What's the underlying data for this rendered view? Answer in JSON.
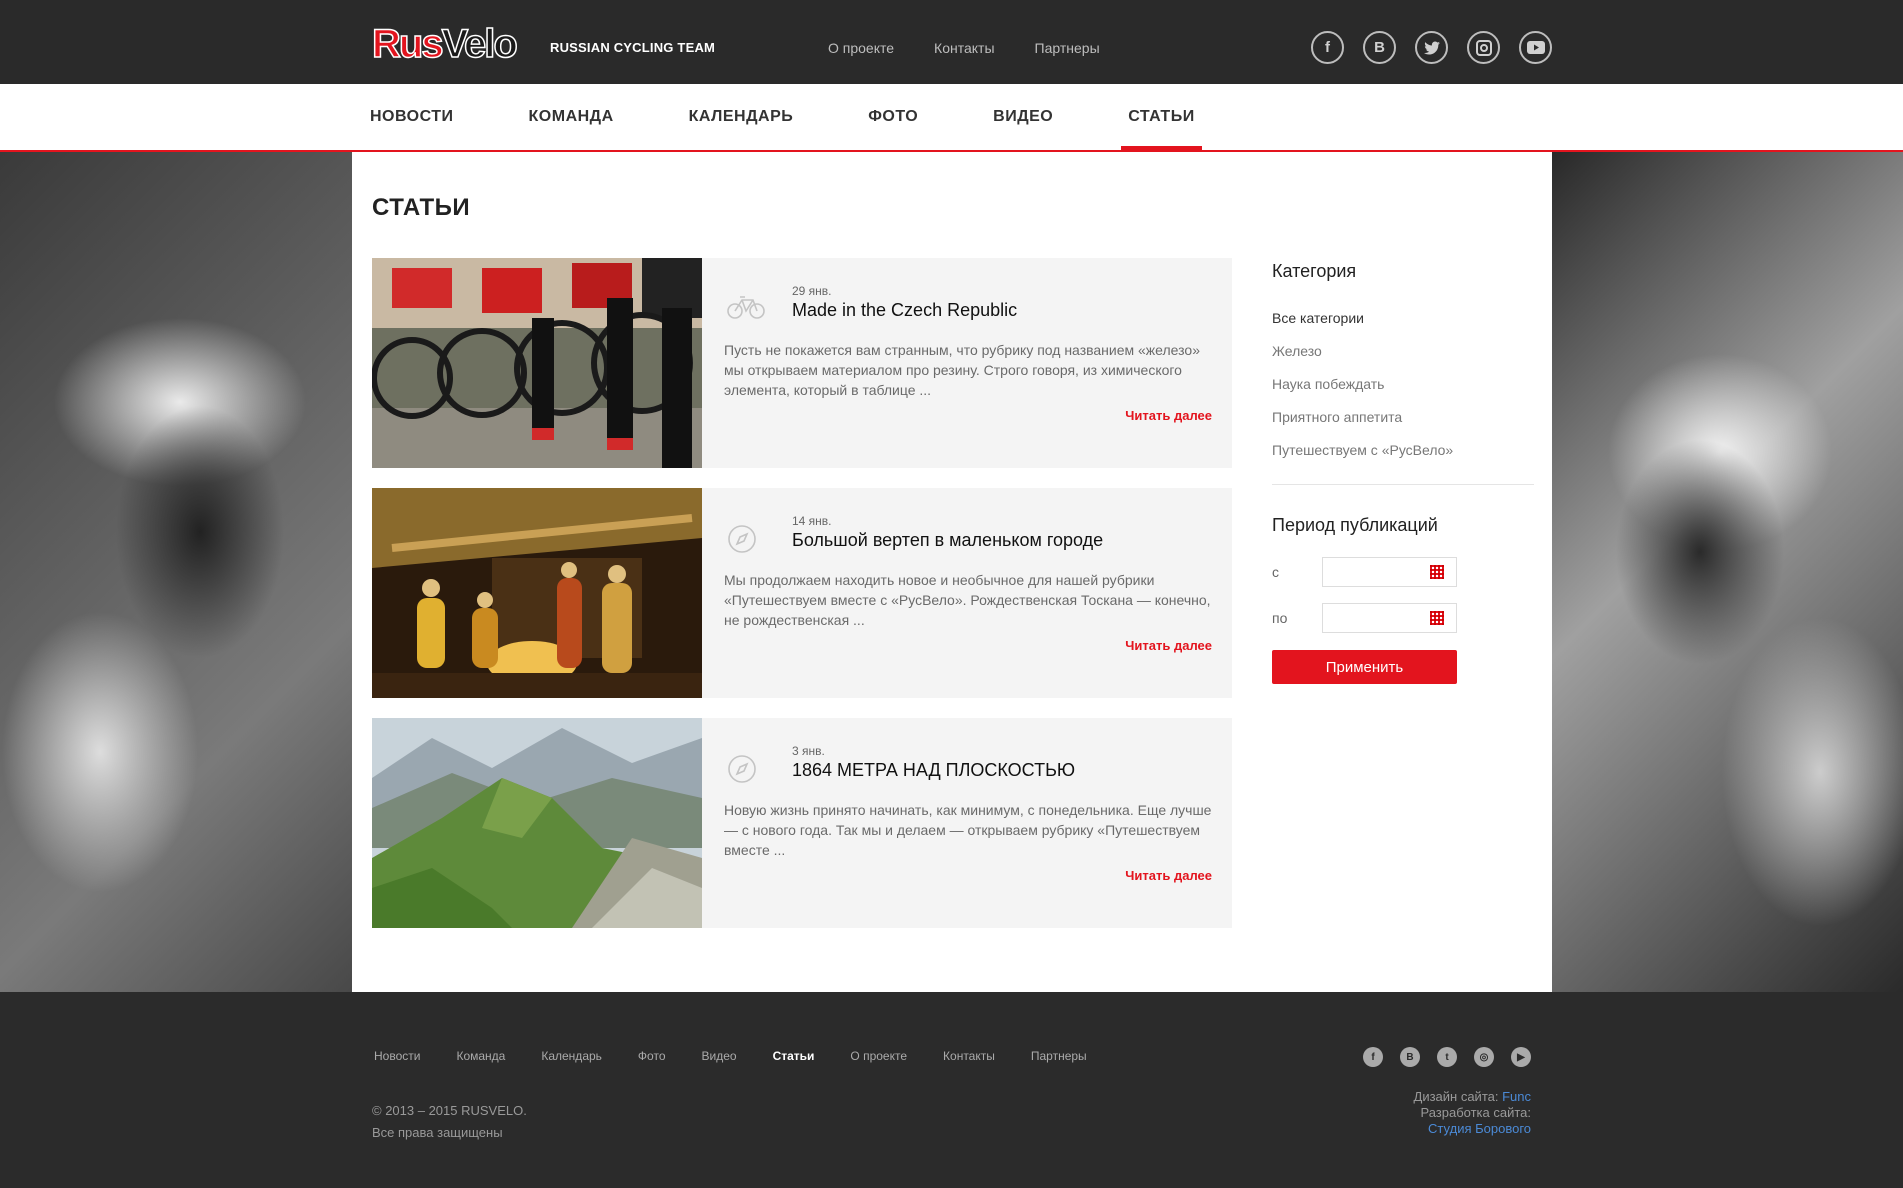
{
  "header": {
    "logo_part1": "Rus",
    "logo_part2": "Velo",
    "tagline": "RUSSIAN CYCLING TEAM",
    "top_links": [
      "О проекте",
      "Контакты",
      "Партнеры"
    ],
    "social_icons": [
      "facebook-icon",
      "vk-icon",
      "twitter-icon",
      "instagram-icon",
      "youtube-icon"
    ]
  },
  "mainnav": {
    "items": [
      "НОВОСТИ",
      "КОМАНДА",
      "КАЛЕНДАРЬ",
      "ФОТО",
      "ВИДЕО",
      "СТАТЬИ"
    ],
    "active_index": 5
  },
  "page": {
    "title": "СТАТЬИ"
  },
  "articles": [
    {
      "date": "29 янв.",
      "title": "Made in the Czech Republic",
      "excerpt": "Пусть не покажется вам странным, что рубрику под названием «железо» мы открываем материалом про резину. Строго говоря, из химического элемента, который в таблице ...",
      "more": "Читать далее",
      "icon": "bicycle-icon"
    },
    {
      "date": "14 янв.",
      "title": "Большой вертеп в маленьком городе",
      "excerpt": "Мы продолжаем находить новое и необычное для нашей рубрики «Путешествуем вместе с «РусВело». Рождественская Тоскана — конечно, не рождественская ...",
      "more": "Читать далее",
      "icon": "compass-icon"
    },
    {
      "date": "3 янв.",
      "title": "1864 МЕТРА НАД ПЛОСКОСТЬЮ",
      "excerpt": "Новую жизнь принято начинать, как минимум, с понедельника. Еще лучше — с нового года. Так мы и делаем — открываем рубрику «Путешествуем вместе ...",
      "more": "Читать далее",
      "icon": "compass-icon"
    }
  ],
  "sidebar": {
    "category_title": "Категория",
    "categories": [
      "Все категории",
      "Железо",
      "Наука побеждать",
      "Приятного аппетита",
      "Путешествуем с «РусВело»"
    ],
    "period_title": "Период публикаций",
    "from_label": "с",
    "to_label": "по",
    "apply_label": "Применить"
  },
  "footer": {
    "nav": [
      "Новости",
      "Команда",
      "Календарь",
      "Фото",
      "Видео",
      "Статьи",
      "О проекте",
      "Контакты",
      "Партнеры"
    ],
    "active_index": 5,
    "copyright": "© 2013 – 2015 RUSVELO.",
    "rights": "Все права защищены",
    "design_label": "Дизайн сайта:",
    "design_link": "Func",
    "dev_label": "Разработка сайта:",
    "dev_link": "Студия Борового"
  },
  "colors": {
    "accent": "#e3141e",
    "dark": "#2a2a2a",
    "link": "#4b8ad6"
  }
}
